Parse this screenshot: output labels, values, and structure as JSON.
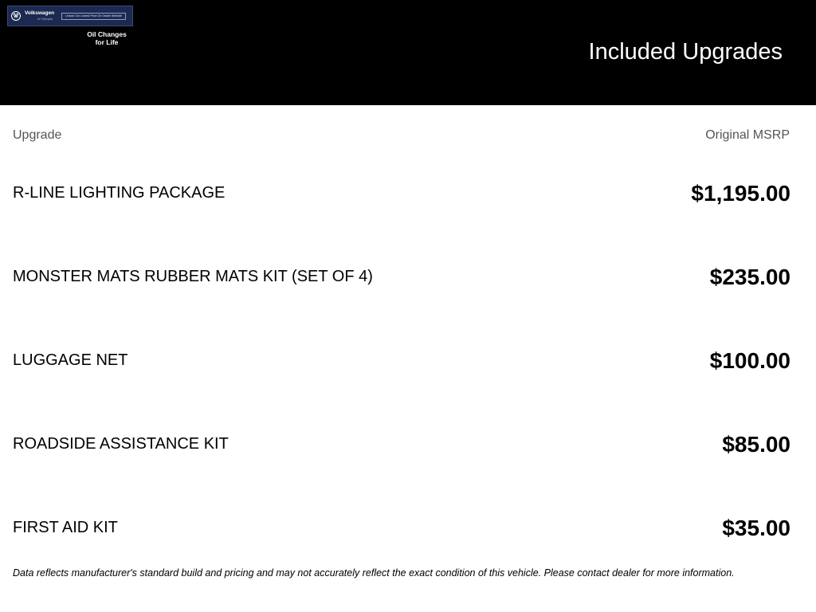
{
  "header": {
    "title": "Included Upgrades",
    "banner": {
      "brand_name": "Volkswagen",
      "brand_sub": "of Olympia",
      "cta_text": "Unlock Our Lowest Price On Dealer Website",
      "tagline_line1": "Oil Changes",
      "tagline_line2": "for Life",
      "icon": "vw-logo-icon",
      "background_color": "#1c2a52"
    }
  },
  "table": {
    "column_upgrade": "Upgrade",
    "column_msrp": "Original MSRP",
    "rows": [
      {
        "name": "R-LINE LIGHTING PACKAGE",
        "price": "$1,195.00"
      },
      {
        "name": "MONSTER MATS RUBBER MATS KIT (SET OF 4)",
        "price": "$235.00"
      },
      {
        "name": "LUGGAGE NET",
        "price": "$100.00"
      },
      {
        "name": "ROADSIDE ASSISTANCE KIT",
        "price": "$85.00"
      },
      {
        "name": "FIRST AID KIT",
        "price": "$35.00"
      }
    ]
  },
  "footer": {
    "disclaimer": "Data reflects manufacturer's standard build and pricing and may not accurately reflect the exact condition of this vehicle. Please contact dealer for more information."
  },
  "colors": {
    "header_bg": "#000000",
    "header_text": "#ffffff",
    "column_header_text": "#555555",
    "body_text": "#000000"
  }
}
